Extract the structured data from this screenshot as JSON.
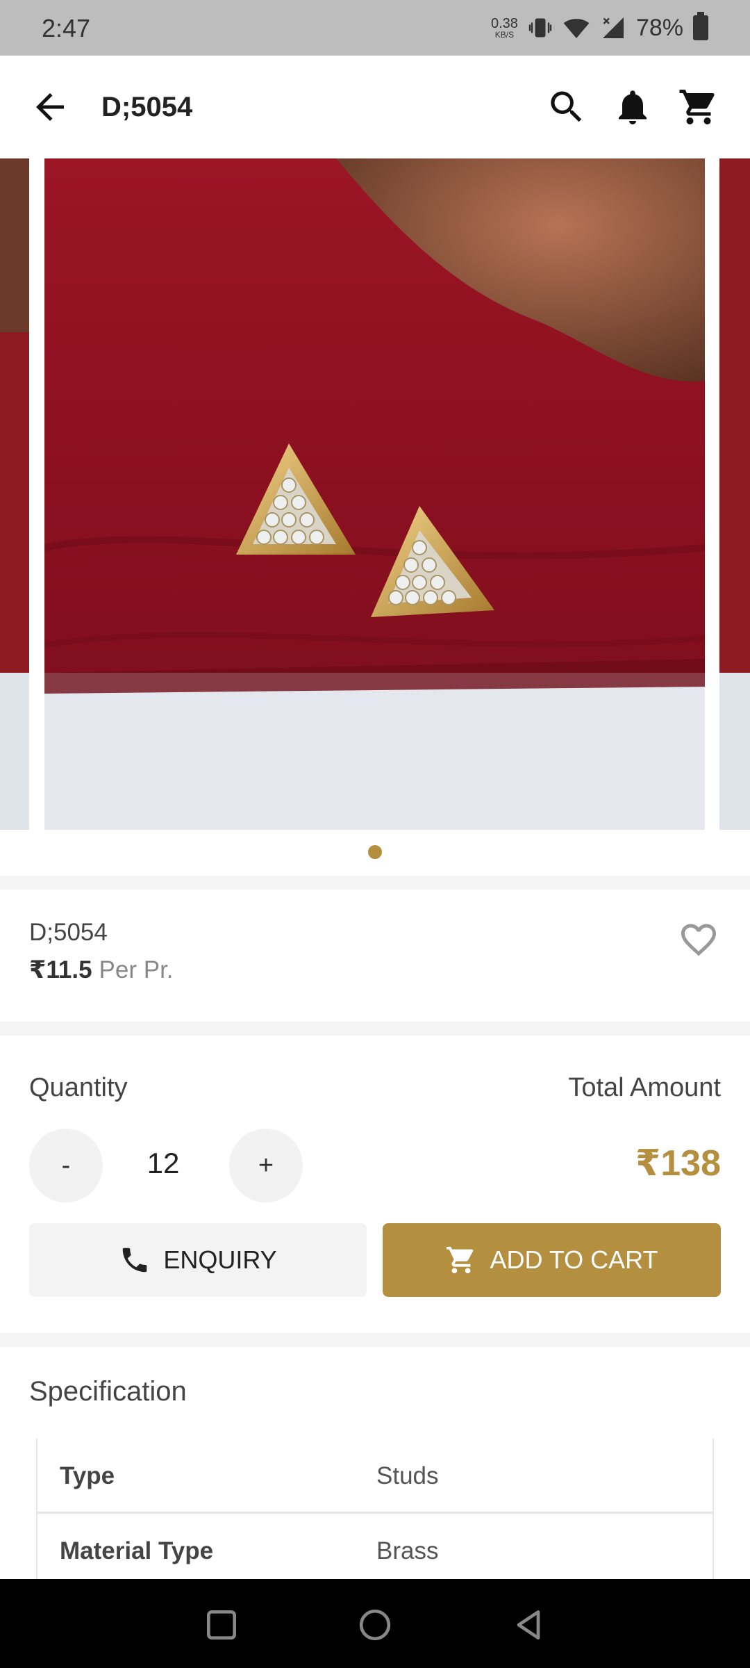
{
  "status_bar": {
    "time": "2:47",
    "net_speed_value": "0.38",
    "net_speed_unit": "KB/S",
    "battery": "78%"
  },
  "app_bar": {
    "title": "D;5054",
    "icons": [
      "back-arrow-icon",
      "search-icon",
      "bell-icon",
      "cart-icon"
    ]
  },
  "carousel": {
    "page_count": 1,
    "active_index": 0,
    "accent_color": "#b38f3f"
  },
  "product": {
    "code": "D;5054",
    "price": "₹11.5",
    "price_unit": "Per Pr."
  },
  "order": {
    "quantity_label": "Quantity",
    "total_label": "Total Amount",
    "decrement_label": "-",
    "quantity_value": "12",
    "increment_label": "+",
    "total_value": "₹138",
    "enquiry_label": "ENQUIRY",
    "add_to_cart_label": "ADD TO CART"
  },
  "specification": {
    "title": "Specification",
    "rows": [
      {
        "key": "Type",
        "value": "Studs"
      },
      {
        "key": "Material Type",
        "value": "Brass"
      }
    ]
  },
  "colors": {
    "accent": "#b38f3f",
    "status_bar": "#bdbdbd",
    "nav_bar": "#000000"
  }
}
